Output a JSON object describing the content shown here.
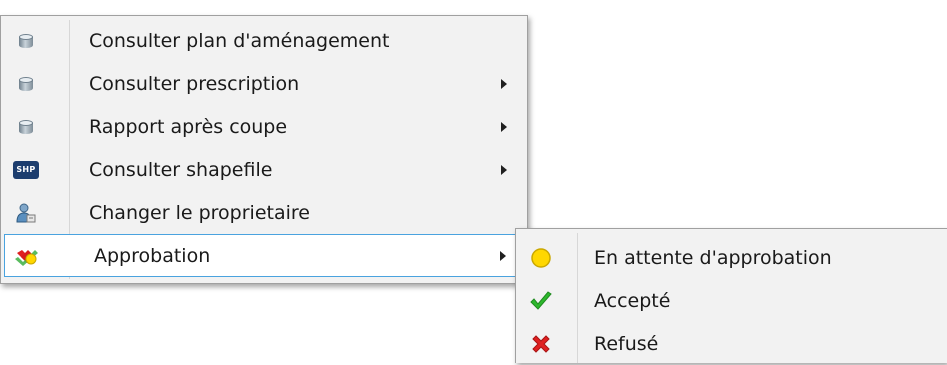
{
  "main_menu": {
    "items": [
      {
        "label": "Consulter plan d'aménagement",
        "icon": "database-icon",
        "has_submenu": false
      },
      {
        "label": "Consulter prescription",
        "icon": "database-icon",
        "has_submenu": true
      },
      {
        "label": "Rapport après coupe",
        "icon": "database-icon",
        "has_submenu": true
      },
      {
        "label": "Consulter shapefile",
        "icon": "shapefile-icon",
        "icon_text": "SHP",
        "has_submenu": true
      },
      {
        "label": "Changer le proprietaire",
        "icon": "user-change-icon",
        "has_submenu": false
      },
      {
        "label": "Approbation",
        "icon": "approval-icon",
        "has_submenu": true,
        "highlighted": true
      }
    ]
  },
  "submenu": {
    "items": [
      {
        "label": "En attente d'approbation",
        "icon": "yellow-circle-icon"
      },
      {
        "label": "Accepté",
        "icon": "green-check-icon"
      },
      {
        "label": "Refusé",
        "icon": "red-x-icon"
      }
    ]
  },
  "colors": {
    "menu_bg": "#f2f2f2",
    "highlight_border": "#4aa3df",
    "pending_yellow": "#ffd700",
    "accepted_green": "#2db82d",
    "refused_red": "#e02020"
  }
}
